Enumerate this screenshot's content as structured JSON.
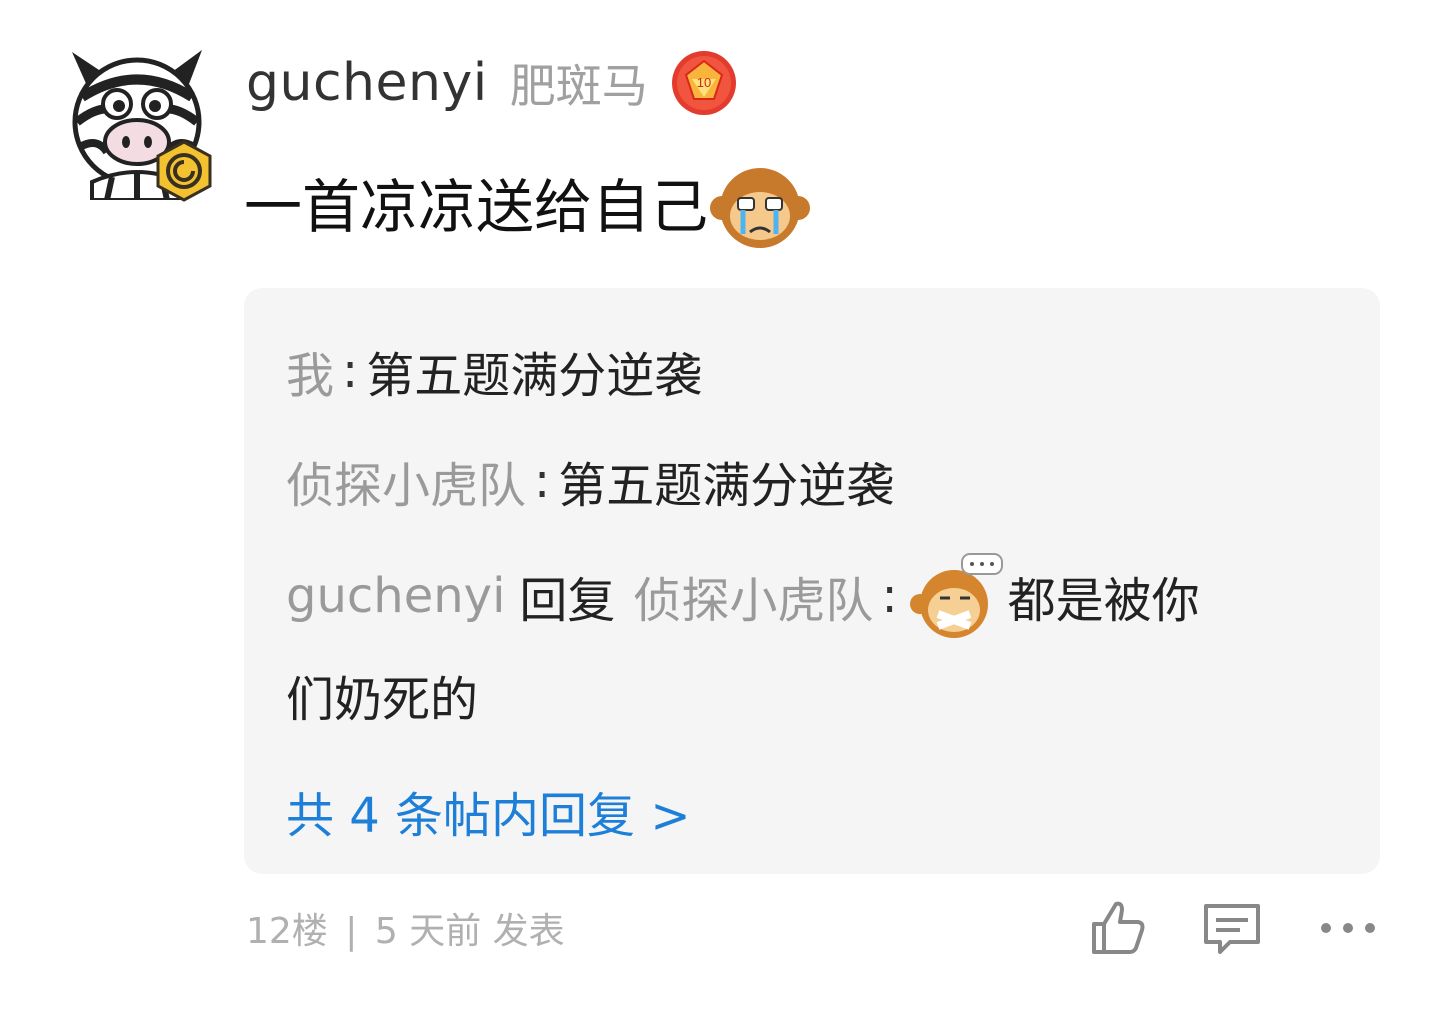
{
  "post": {
    "username": "guchenyi",
    "nickname": "肥斑马",
    "content": "一首凉凉送给自己",
    "emoji_icons": [
      "monkey-cry-icon",
      "monkey-gag-icon"
    ],
    "badges": [
      "level-badge-icon",
      "vip-badge-icon"
    ]
  },
  "replies": [
    {
      "author": "我",
      "sep": ":",
      "text": "第五题满分逆袭"
    },
    {
      "author": "侦探小虎队",
      "sep": ":",
      "text": "第五题满分逆袭"
    },
    {
      "author": "guchenyi",
      "verb": "回复",
      "target": "侦探小虎队",
      "sep": ":",
      "text_line1": "都是被你",
      "text_line2": "们奶死的"
    }
  ],
  "more_replies": "共 4 条帖内回复 >",
  "footer": {
    "floor": "12楼",
    "divider": "|",
    "time": "5 天前",
    "action": "发表"
  },
  "actions": [
    "like-icon",
    "comment-icon",
    "more-icon"
  ],
  "colors": {
    "link": "#1e7fd8",
    "muted": "#a0a0a0",
    "reply_bg": "#f5f5f5"
  }
}
